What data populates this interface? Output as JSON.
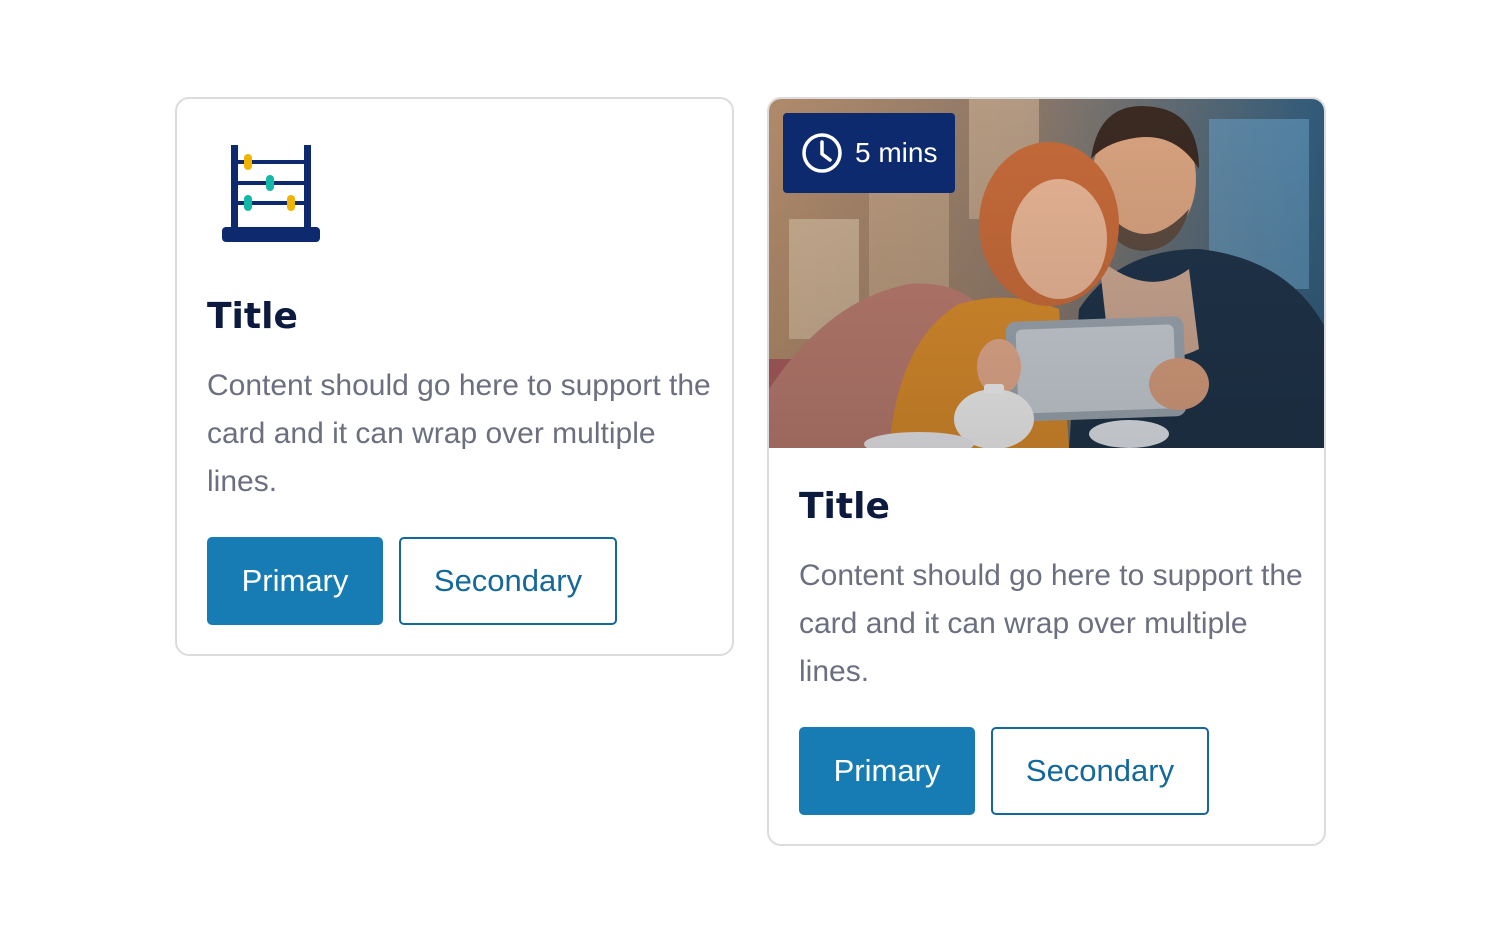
{
  "cards": [
    {
      "icon": "abacus-icon",
      "title": "Title",
      "body": "Content should go here to support the card and it can wrap over multiple lines.",
      "primary_label": "Primary",
      "secondary_label": "Secondary"
    },
    {
      "image": "couple-with-tablet-photo",
      "badge": {
        "icon": "clock-icon",
        "label": "5 mins"
      },
      "title": "Title",
      "body": "Content should go here to support the card and it can wrap over multiple lines.",
      "primary_label": "Primary",
      "secondary_label": "Secondary"
    }
  ],
  "colors": {
    "navy": "#0e2a6e",
    "primary_button": "#177cb4",
    "secondary_border": "#15689a",
    "body_text": "#6c6f80",
    "title_text": "#0c1a40",
    "abacus_yellow": "#f0b400",
    "abacus_teal": "#13b8a6"
  }
}
